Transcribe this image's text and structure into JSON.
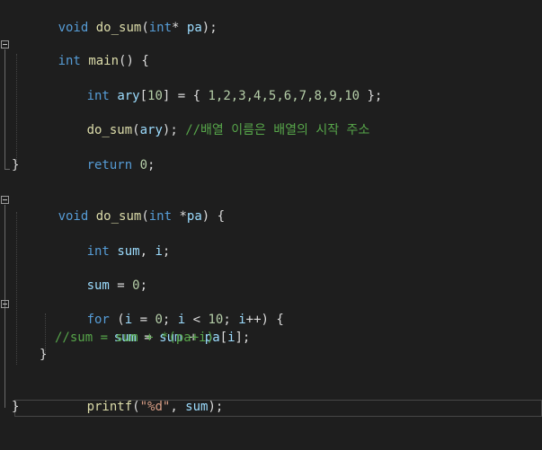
{
  "code": {
    "l1": {
      "kw": "void",
      "fn": "do_sum",
      "p1": "(",
      "kw2": "int",
      "p2": "*",
      "id": "pa",
      "p3": ");"
    },
    "l2": {
      "kw": "int",
      "fn": "main",
      "p": "() {"
    },
    "l3": {
      "kw": "int",
      "id": "ary",
      "p1": "[",
      "n1": "10",
      "p2": "] = { ",
      "nums": "1,2,3,4,5,6,7,8,9,10",
      "p3": " };"
    },
    "l4": {
      "fn": "do_sum",
      "p1": "(",
      "id": "ary",
      "p2": "); ",
      "cm": "//배열 이름은 배열의 시작 주소"
    },
    "l5": {
      "kw": "return",
      "n": "0",
      "p": ";"
    },
    "l6": {
      "p": "}"
    },
    "l7": {
      "kw": "void",
      "fn": "do_sum",
      "p1": "(",
      "kw2": "int",
      "p2": " *",
      "id": "pa",
      "p3": ") {"
    },
    "l8": {
      "kw": "int",
      "id": "sum",
      "p1": ", ",
      "id2": "i",
      "p2": ";"
    },
    "l9": {
      "id": "sum",
      "p1": " = ",
      "n": "0",
      "p2": ";"
    },
    "l10": {
      "kw": "for",
      "p1": " (",
      "id": "i",
      "p2": " = ",
      "n": "0",
      "p3": "; ",
      "id2": "i",
      "p4": " < ",
      "n2": "10",
      "p5": "; ",
      "id3": "i",
      "p6": "++) {"
    },
    "l11": {
      "id": "sum",
      "p1": " = ",
      "id2": "sum",
      "p2": " + ",
      "id3": "pa",
      "p3": "[",
      "id4": "i",
      "p4": "];"
    },
    "l12": {
      "cm": "//sum = sum + *(pa+i)"
    },
    "l13": {
      "p": "}"
    },
    "l14": {
      "fn": "printf",
      "p1": "(",
      "str": "\"%d\"",
      "p2": ", ",
      "id": "sum",
      "p3": ");"
    },
    "l15": {
      "p": "}"
    }
  },
  "colors": {
    "background": "#1e1e1e",
    "keyword": "#569cd6",
    "function": "#dcdcaa",
    "identifier": "#9cdcfe",
    "number": "#b5cea8",
    "string": "#d69d85",
    "comment": "#57a64a",
    "punctuation": "#dcdcdc"
  }
}
